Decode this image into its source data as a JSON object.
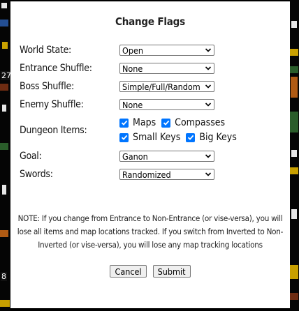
{
  "dialog": {
    "title": "Change Flags",
    "fields": {
      "world_state": {
        "label": "World State:",
        "value": "Open"
      },
      "entrance_shuffle": {
        "label": "Entrance Shuffle:",
        "value": "None"
      },
      "boss_shuffle": {
        "label": "Boss Shuffle:",
        "value": "Simple/Full/Random"
      },
      "enemy_shuffle": {
        "label": "Enemy Shuffle:",
        "value": "None"
      },
      "dungeon_items": {
        "label": "Dungeon Items:",
        "maps": "Maps",
        "compasses": "Compasses",
        "small_keys": "Small Keys",
        "big_keys": "Big Keys"
      },
      "goal": {
        "label": "Goal:",
        "value": "Ganon"
      },
      "swords": {
        "label": "Swords:",
        "value": "Randomized"
      }
    },
    "note": "NOTE: If you change from Entrance to Non-Entrance (or vise-versa), you will lose all items and map locations tracked. If you switch from Inverted to Non-Inverted (or vise-versa), you will lose any map tracking locations",
    "buttons": {
      "cancel": "Cancel",
      "submit": "Submit"
    }
  },
  "background": {
    "digits": [
      "27",
      "8"
    ]
  },
  "colors": {
    "checkbox": "#0075ff",
    "dialog_bg": "#ffffff",
    "page_bg": "#000000"
  },
  "icons": {
    "select_arrow": "chevron-down-icon",
    "checkbox_mark": "check-icon"
  }
}
